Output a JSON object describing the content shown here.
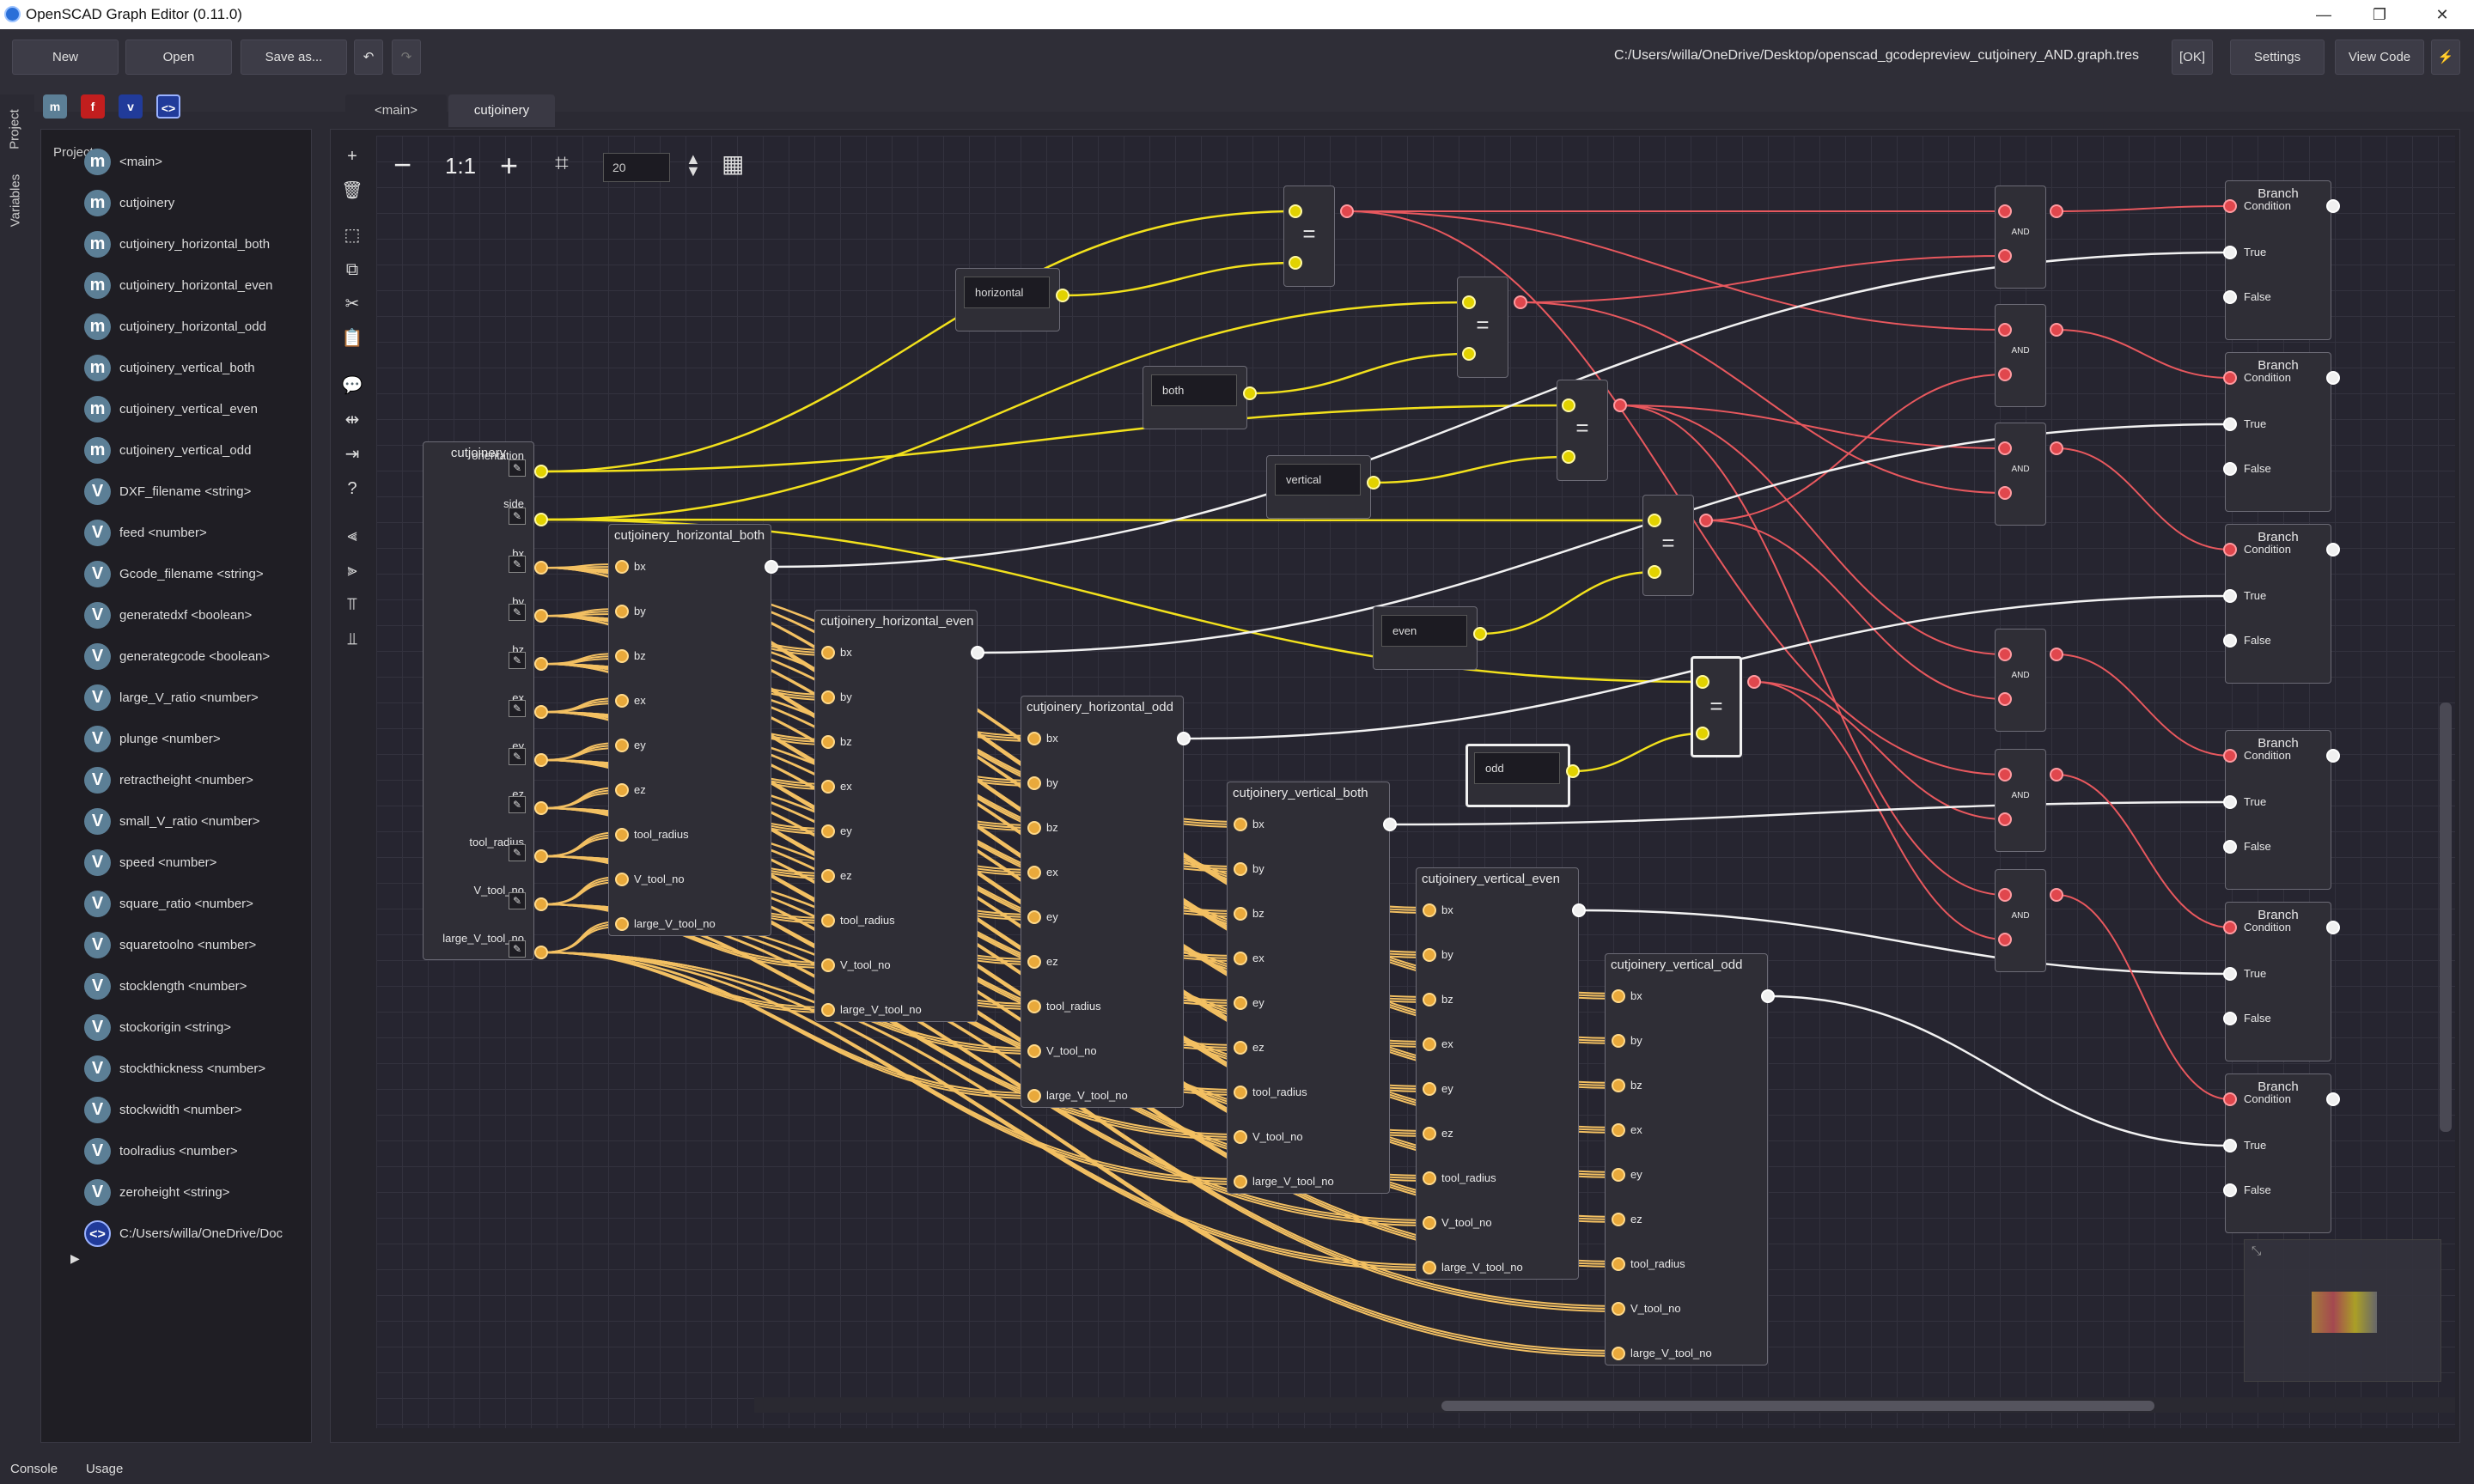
{
  "window": {
    "title": "OpenSCAD Graph Editor (0.11.0)"
  },
  "toolbar": {
    "new": "New",
    "open": "Open",
    "save_as": "Save as...",
    "undo_icon": "undo-icon",
    "redo_icon": "redo-icon",
    "path": "C:/Users/willa/OneDrive/Desktop/openscad_gcodepreview_cutjoinery_AND.graph.tres",
    "ok": "[OK]",
    "settings": "Settings",
    "view_code": "View Code"
  },
  "sidetabs": {
    "project": "Project",
    "variables": "Variables"
  },
  "filter_chips": [
    "m",
    "f",
    "v",
    "<>"
  ],
  "project": {
    "header": "Project",
    "items": [
      {
        "icon": "m",
        "label": "<main>"
      },
      {
        "icon": "m",
        "label": "cutjoinery"
      },
      {
        "icon": "m",
        "label": "cutjoinery_horizontal_both"
      },
      {
        "icon": "m",
        "label": "cutjoinery_horizontal_even"
      },
      {
        "icon": "m",
        "label": "cutjoinery_horizontal_odd"
      },
      {
        "icon": "m",
        "label": "cutjoinery_vertical_both"
      },
      {
        "icon": "m",
        "label": "cutjoinery_vertical_even"
      },
      {
        "icon": "m",
        "label": "cutjoinery_vertical_odd"
      },
      {
        "icon": "V",
        "label": "DXF_filename <string>"
      },
      {
        "icon": "V",
        "label": "feed <number>"
      },
      {
        "icon": "V",
        "label": "Gcode_filename <string>"
      },
      {
        "icon": "V",
        "label": "generatedxf <boolean>"
      },
      {
        "icon": "V",
        "label": "generategcode <boolean>"
      },
      {
        "icon": "V",
        "label": "large_V_ratio <number>"
      },
      {
        "icon": "V",
        "label": "plunge <number>"
      },
      {
        "icon": "V",
        "label": "retractheight <number>"
      },
      {
        "icon": "V",
        "label": "small_V_ratio <number>"
      },
      {
        "icon": "V",
        "label": "speed <number>"
      },
      {
        "icon": "V",
        "label": "square_ratio <number>"
      },
      {
        "icon": "V",
        "label": "squaretoolno <number>"
      },
      {
        "icon": "V",
        "label": "stocklength <number>"
      },
      {
        "icon": "V",
        "label": "stockorigin <string>"
      },
      {
        "icon": "V",
        "label": "stockthickness <number>"
      },
      {
        "icon": "V",
        "label": "stockwidth <number>"
      },
      {
        "icon": "V",
        "label": "toolradius <number>"
      },
      {
        "icon": "V",
        "label": "zeroheight <string>"
      },
      {
        "icon": "<>",
        "label": "C:/Users/willa/OneDrive/Doc"
      }
    ]
  },
  "tabs": [
    "<main>",
    "cutjoinery"
  ],
  "canvas_toolbar": {
    "zoom_out": "−",
    "zoom_reset": "1:1",
    "zoom_in": "+",
    "snap_value": "20"
  },
  "graph": {
    "entry_node": {
      "title": "cutjoinery",
      "ports": [
        "orientation",
        "side",
        "bx",
        "by",
        "bz",
        "ex",
        "ey",
        "ez",
        "tool_radius",
        "V_tool_no",
        "large_V_tool_no"
      ]
    },
    "module_ports": [
      "bx",
      "by",
      "bz",
      "ex",
      "ey",
      "ez",
      "tool_radius",
      "V_tool_no",
      "large_V_tool_no"
    ],
    "modules": [
      "cutjoinery_horizontal_both",
      "cutjoinery_horizontal_even",
      "cutjoinery_horizontal_odd",
      "cutjoinery_vertical_both",
      "cutjoinery_vertical_even",
      "cutjoinery_vertical_odd"
    ],
    "strings": [
      "horizontal",
      "both",
      "vertical",
      "even",
      "odd"
    ],
    "eq_symbol": "=",
    "and_label": "AND",
    "branch": {
      "title": "Branch",
      "condition": "Condition",
      "true": "True",
      "false": "False"
    }
  },
  "status": {
    "console": "Console",
    "usage": "Usage"
  },
  "colors": {
    "bg": "#2b2a33",
    "wire_yellow": "#f2e11c",
    "wire_orange": "#f3c062",
    "wire_red": "#e8585e",
    "wire_white": "#f2f2f2"
  }
}
